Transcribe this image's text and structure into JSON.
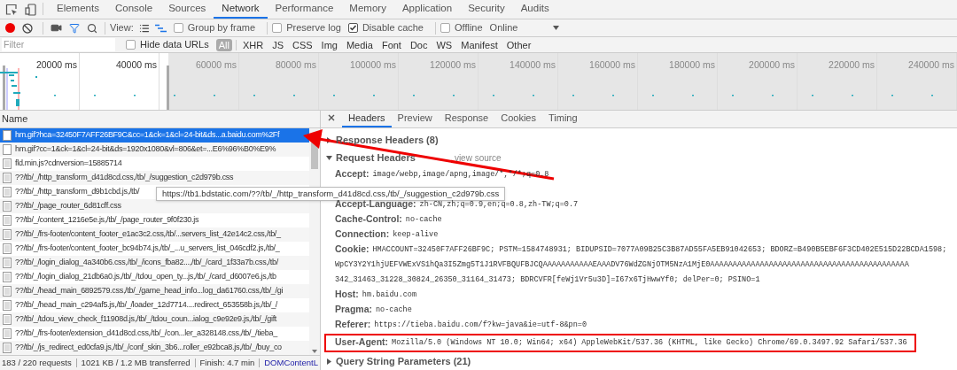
{
  "devtools_tabs": [
    {
      "label": "Elements",
      "selected": false
    },
    {
      "label": "Console",
      "selected": false
    },
    {
      "label": "Sources",
      "selected": false
    },
    {
      "label": "Network",
      "selected": true
    },
    {
      "label": "Performance",
      "selected": false
    },
    {
      "label": "Memory",
      "selected": false
    },
    {
      "label": "Application",
      "selected": false
    },
    {
      "label": "Security",
      "selected": false
    },
    {
      "label": "Audits",
      "selected": false
    }
  ],
  "toolbar": {
    "recording": true,
    "filter_active": true,
    "view_label": "View:",
    "waterfall": true,
    "options": [
      {
        "label": "Group by frame",
        "checked": false
      },
      {
        "label": "Preserve log",
        "checked": false
      },
      {
        "label": "Disable cache",
        "checked": true
      },
      {
        "label": "Offline",
        "checked": false
      }
    ],
    "throttling": "Online"
  },
  "filter_bar": {
    "placeholder": "Filter",
    "hide_data_urls": {
      "label": "Hide data URLs",
      "checked": false
    },
    "types": [
      {
        "label": "All",
        "selected": true
      },
      {
        "label": "XHR",
        "selected": false
      },
      {
        "label": "JS",
        "selected": false
      },
      {
        "label": "CSS",
        "selected": false
      },
      {
        "label": "Img",
        "selected": false
      },
      {
        "label": "Media",
        "selected": false
      },
      {
        "label": "Font",
        "selected": false
      },
      {
        "label": "Doc",
        "selected": false
      },
      {
        "label": "WS",
        "selected": false
      },
      {
        "label": "Manifest",
        "selected": false
      },
      {
        "label": "Other",
        "selected": false
      }
    ]
  },
  "timeline": {
    "ticks": [
      "20000 ms",
      "40000 ms",
      "60000 ms",
      "80000 ms",
      "100000 ms",
      "120000 ms",
      "140000 ms",
      "160000 ms",
      "180000 ms",
      "200000 ms",
      "220000 ms",
      "240000 ms"
    ]
  },
  "requests": {
    "column": "Name",
    "rows": [
      {
        "name": "hm.gif?hca=32450F7AFF26BF9C&cc=1&ck=1&cl=24-bit&ds...a.baidu.com%2Ff",
        "kind": "blank",
        "selected": true
      },
      {
        "name": "hm.gif?cc=1&ck=1&cl=24-bit&ds=1920x1080&vl=806&et=...E6%96%B0%E9%",
        "kind": "blank",
        "selected": false
      },
      {
        "name": "fld.min.js?cdnversion=15885714",
        "kind": "doc",
        "selected": false
      },
      {
        "name": "??/tb/_/http_transform_d41d8cd.css,/tb/_/suggestion_c2d979b.css",
        "kind": "doc",
        "selected": false
      },
      {
        "name": "??/tb/_/http_transform_d9b1cbd.js,/tb/",
        "kind": "doc",
        "selected": false
      },
      {
        "name": "??/tb/_/page_router_6d81cff.css",
        "kind": "doc",
        "selected": false
      },
      {
        "name": "??/tb/_/content_1216e5e.js,/tb/_/page_router_9f0f230.js",
        "kind": "doc",
        "selected": false
      },
      {
        "name": "??/tb/_/frs-footer/content_footer_e1ac3c2.css,/tb/...servers_list_42e14c2.css,/tb/_",
        "kind": "doc",
        "selected": false
      },
      {
        "name": "??/tb/_/frs-footer/content_footer_bc94b74.js,/tb/_...u_servers_list_046cdf2.js,/tb/_",
        "kind": "doc",
        "selected": false
      },
      {
        "name": "??/tb/_/login_dialog_4a340b6.css,/tb/_/icons_fba82...,/tb/_/card_1f33a7b.css,/tb/",
        "kind": "doc",
        "selected": false
      },
      {
        "name": "??/tb/_/login_dialog_21db6a0.js,/tb/_/tdou_open_ty...js,/tb/_/card_d6007e6.js,/tb",
        "kind": "doc",
        "selected": false
      },
      {
        "name": "??/tb/_/head_main_6892579.css,/tb/_/game_head_info...log_da61760.css,/tb/_/gi",
        "kind": "doc",
        "selected": false
      },
      {
        "name": "??/tb/_/head_main_c294af5.js,/tb/_/loader_12d7714....redirect_653558b.js,/tb/_/",
        "kind": "doc",
        "selected": false
      },
      {
        "name": "??/tb/_/tdou_view_check_f11908d.js,/tb/_/tdou_coun...ialog_c9e92e9.js,/tb/_/gift",
        "kind": "doc",
        "selected": false
      },
      {
        "name": "??/tb/_/frs-footer/extension_d41d8cd.css,/tb/_/con...ler_a328148.css,/tb/_/tieba_",
        "kind": "doc",
        "selected": false
      },
      {
        "name": "??/tb/_/js_redirect_ed0cfa9.js,/tb/_/conf_skin_3b6...roller_e92bca8.js,/tb/_/buy_co",
        "kind": "doc",
        "selected": false
      }
    ],
    "status": [
      "183 / 220 requests",
      "1021 KB / 1.2 MB transferred",
      "Finish: 4.7 min"
    ],
    "status_link": "DOMContentL"
  },
  "tooltip": "https://tb1.bdstatic.com/??/tb/_/http_transform_d41d8cd.css,/tb/_/suggestion_c2d979b.css",
  "details": {
    "tabs": [
      {
        "label": "Headers",
        "selected": true
      },
      {
        "label": "Preview",
        "selected": false
      },
      {
        "label": "Response",
        "selected": false
      },
      {
        "label": "Cookies",
        "selected": false
      },
      {
        "label": "Timing",
        "selected": false
      }
    ],
    "sections": [
      {
        "title": "Response Headers (8)",
        "expanded": false
      },
      {
        "title": "Request Headers",
        "expanded": true,
        "link": "view source",
        "headers": [
          {
            "kind": "header",
            "name": "Accept:",
            "lines": [
              "image/webp,image/apng,image/*,*/*;q=0.8"
            ],
            "highlighted": false
          },
          {
            "kind": "covered"
          },
          {
            "kind": "header",
            "name": "Accept-Language:",
            "lines": [
              "zh-CN,zh;q=0.9,en;q=0.8,zh-TW;q=0.7"
            ],
            "highlighted": false
          },
          {
            "kind": "header",
            "name": "Cache-Control:",
            "lines": [
              "no-cache"
            ],
            "highlighted": false
          },
          {
            "kind": "header",
            "name": "Connection:",
            "lines": [
              "keep-alive"
            ],
            "highlighted": false
          },
          {
            "kind": "header",
            "name": "Cookie:",
            "lines": [
              "HMACCOUNT=32450F7AFF26BF9C; PSTM=1584748931; BIDUPSID=7077A09B25C3B87AD55FA5EB91042653; BDORZ=B490B5EBF6F3CD402E515D22BCDA1598;",
              "WpCY3Y2Y1hjUEFVWExVS1hQa3I5Zmg5T1J1RVFBQUFBJCQAAAAAAAAAAAEAAADV76WdZGNjOTM5NzA1MjE0AAAAAAAAAAAAAAAAAAAAAAAAAAAAAAAAAAAAAAAAAAAA",
              "342_31463_31228_30824_26350_31164_31473; BDRCVFR[feWj1Vr5u3D]=I67x6TjHwwYf0; delPer=0; PSINO=1"
            ],
            "highlighted": false
          },
          {
            "kind": "header",
            "name": "Host:",
            "lines": [
              "hm.baidu.com"
            ],
            "highlighted": false
          },
          {
            "kind": "header",
            "name": "Pragma:",
            "lines": [
              "no-cache"
            ],
            "highlighted": false
          },
          {
            "kind": "header",
            "name": "Referer:",
            "lines": [
              "https://tieba.baidu.com/f?kw=java&ie=utf-8&pn=0"
            ],
            "highlighted": false
          },
          {
            "kind": "header",
            "name": "User-Agent:",
            "lines": [
              "Mozilla/5.0 (Windows NT 10.0; Win64; x64) AppleWebKit/537.36 (KHTML, like Gecko) Chrome/69.0.3497.92 Safari/537.36"
            ],
            "highlighted": true
          }
        ]
      },
      {
        "title": "Query String Parameters (21)",
        "expanded": false
      }
    ]
  }
}
